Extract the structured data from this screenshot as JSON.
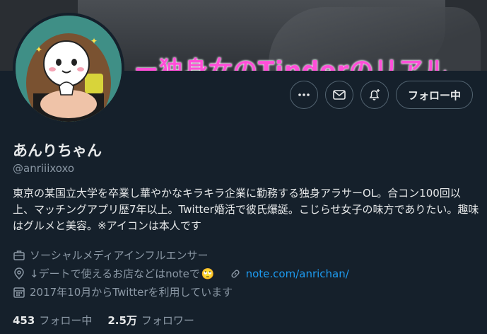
{
  "banner": {
    "text": "ー独身女のTinderのリアル"
  },
  "avatar": {
    "alt": "profile avatar"
  },
  "actions": {
    "more_icon": "more-icon",
    "message_icon": "mail-icon",
    "notify_icon": "bell-plus-icon",
    "follow_label": "フォロー中"
  },
  "profile": {
    "name": "あんりちゃん",
    "handle": "@anriiixoxo",
    "bio": "東京の某国立大学を卒業し華やかなキラキラ企業に勤務する独身アラサーOL。合コン100回以上、マッチングアプリ歴7年以上。Twitter婚活で彼氏爆誕。こじらせ女子の味方でありたい。趣味はグルメと美容。※アイコンは本人です",
    "category": "ソーシャルメディアインフルエンサー",
    "location": "↓デートで使えるお店などはnoteで",
    "location_emoji": "🙄",
    "link": "note.com/anrichan/",
    "joined": "2017年10月からTwitterを利用しています"
  },
  "stats": {
    "following_count": "453",
    "following_label": "フォロー中",
    "followers_count": "2.5万",
    "followers_label": "フォロワー"
  },
  "colors": {
    "bg": "#15202b",
    "text": "#e7e9ea",
    "muted": "#8b98a5",
    "link": "#1d9bf0",
    "border": "#536471"
  }
}
